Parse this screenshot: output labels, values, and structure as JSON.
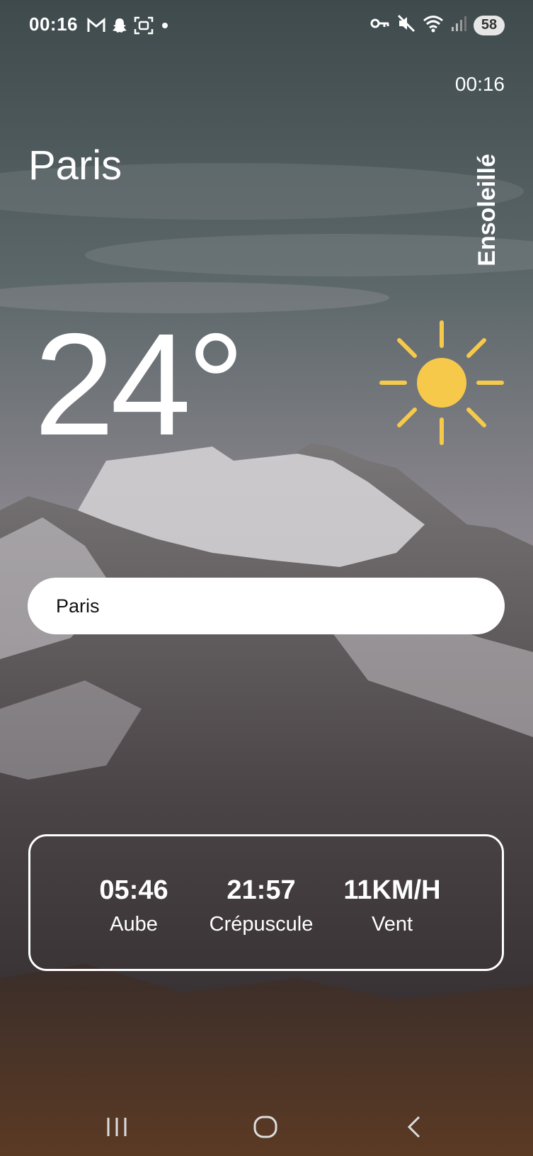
{
  "status_bar": {
    "time": "00:16",
    "left_icons": [
      "gmail-icon",
      "snapchat-icon",
      "screenshot-icon",
      "dot-icon"
    ],
    "right_icons": [
      "key-icon",
      "mute-icon",
      "wifi-icon",
      "signal-icon"
    ],
    "battery": "58"
  },
  "header": {
    "clock": "00:16",
    "city": "Paris",
    "condition": "Ensoleillé"
  },
  "weather": {
    "temperature": "24°",
    "icon": "sun-icon",
    "sun_color": "#f6c94a"
  },
  "search": {
    "value": "Paris"
  },
  "stats": [
    {
      "value": "05:46",
      "label": "Aube"
    },
    {
      "value": "21:57",
      "label": "Crépuscule"
    },
    {
      "value": "11KM/H",
      "label": "Vent"
    }
  ],
  "nav_bar": {
    "buttons": [
      "recent-apps-icon",
      "home-icon",
      "back-icon"
    ]
  }
}
